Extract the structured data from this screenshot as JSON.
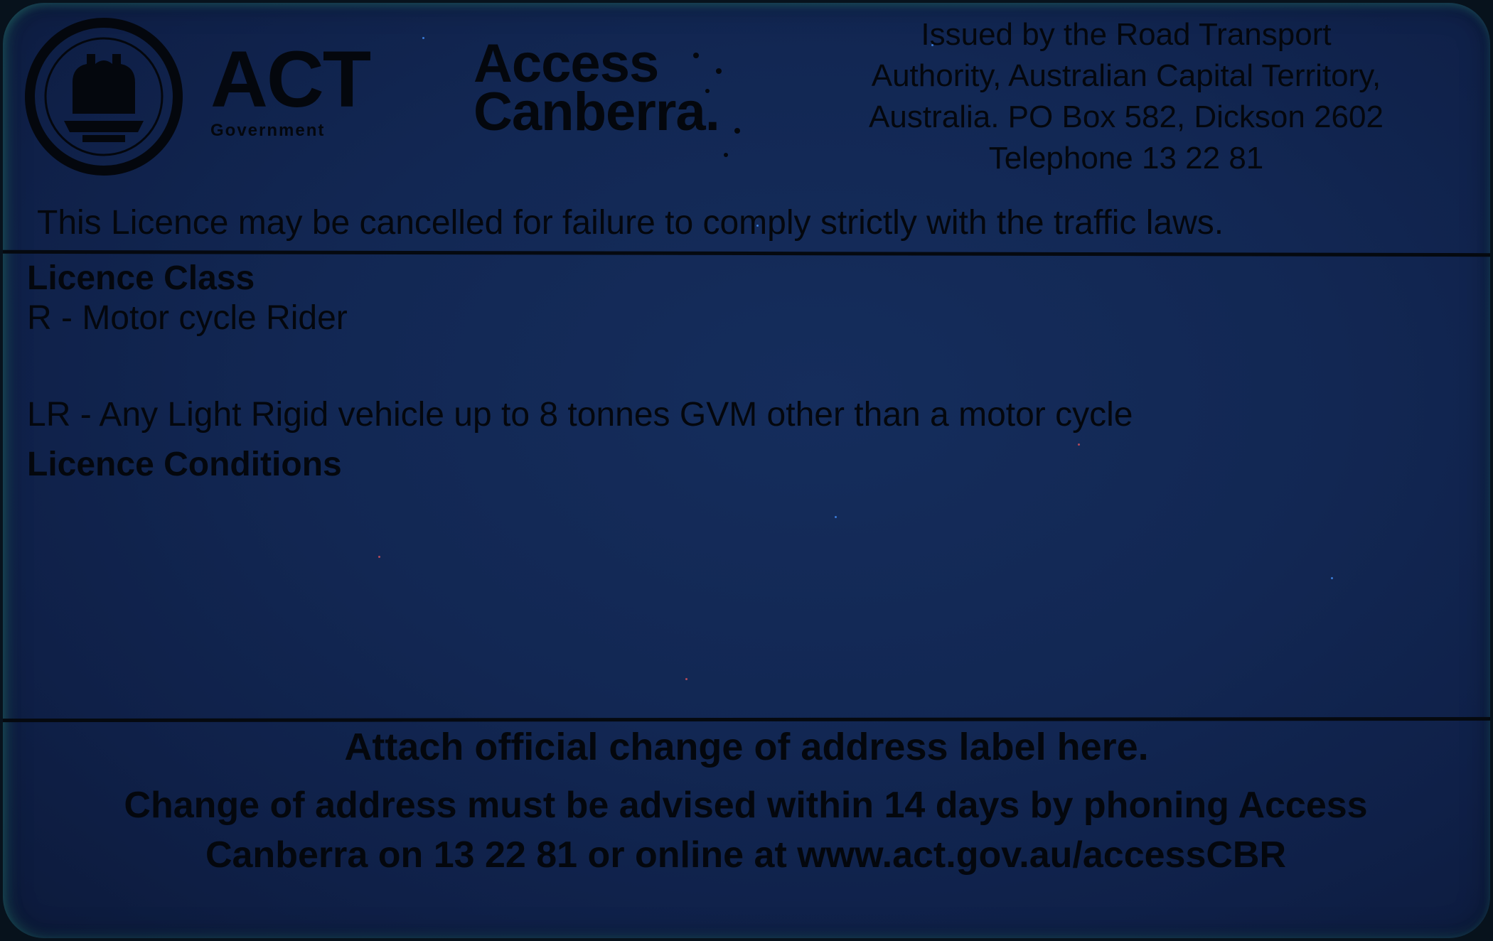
{
  "header": {
    "logo_primary": "ACT",
    "logo_secondary": "Government",
    "service_logo_line1": "Access",
    "service_logo_line2": "Canberra.",
    "issuer_lines": [
      "Issued by the Road Transport",
      "Authority, Australian Capital Territory,",
      "Australia. PO Box 582, Dickson 2602",
      "Telephone 13 22 81"
    ]
  },
  "warning": "This Licence may be cancelled for failure to comply strictly with the traffic laws.",
  "licence_class": {
    "heading": "Licence Class",
    "entries": [
      "R - Motor cycle Rider",
      "LR - Any Light Rigid vehicle up to 8 tonnes GVM other than a motor cycle"
    ]
  },
  "licence_conditions": {
    "heading": "Licence Conditions"
  },
  "address_change": {
    "label_area": "Attach official change of address label here.",
    "note_line1": "Change of address must be advised within 14 days by phoning Access",
    "note_line2": "Canberra on 13 22 81 or online at www.act.gov.au/accessCBR"
  },
  "colors": {
    "card_background": "#122753",
    "ink": "#04070d"
  }
}
